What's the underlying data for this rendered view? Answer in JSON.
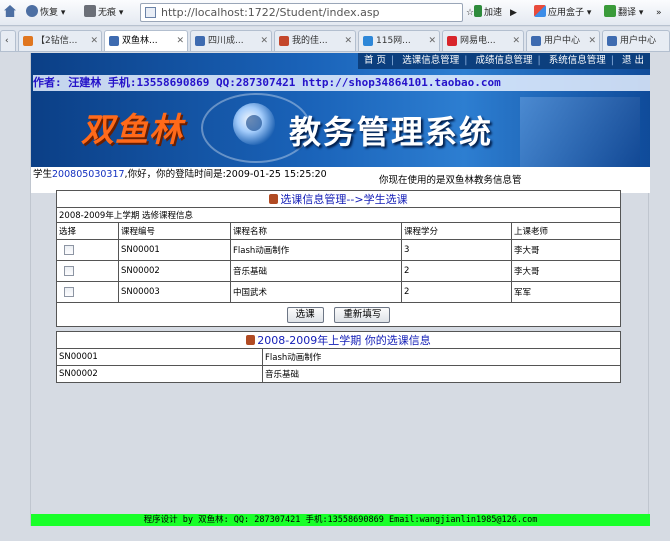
{
  "browser": {
    "back_label": "恢复",
    "mode_label": "无痕",
    "address": "http://localhost:1722/Student/index.asp",
    "accel_label": "加速",
    "appbox_label": "应用盒子",
    "translate_label": "翻译"
  },
  "tabs": [
    {
      "label": "【2钻信...",
      "active": false
    },
    {
      "label": "双鱼林...",
      "active": true
    },
    {
      "label": "四川成...",
      "active": false
    },
    {
      "label": "我的佳...",
      "active": false
    },
    {
      "label": "115网...",
      "active": false
    },
    {
      "label": "网易电...",
      "active": false
    },
    {
      "label": "用户中心",
      "active": false
    },
    {
      "label": "用户中心",
      "active": false
    }
  ],
  "topnav": {
    "home": "首 页",
    "select_mgmt": "选课信息管理",
    "score_mgmt": "成绩信息管理",
    "system_mgmt": "系统信息管理",
    "logout": "退 出"
  },
  "banner": {
    "author_line": "作者: 汪建林  手机:13558690869 QQ:287307421 http://shop34864101.taobao.com",
    "logo_brand": "双鱼林",
    "logo_title": "教务管理系统"
  },
  "welcome": {
    "prefix": "学生",
    "student_id": "200805030317",
    "suffix": ",你好，你的登陆时间是:2009-01-25 15:25:20",
    "system_note": "你现在使用的是双鱼林教务信息管"
  },
  "select_form": {
    "header": "选课信息管理-->学生选课",
    "term_line": "2008-2009年上学期  选修课程信息",
    "columns": [
      "选择",
      "课程编号",
      "课程名称",
      "课程学分",
      "上课老师"
    ],
    "rows": [
      {
        "code": "SN00001",
        "name": "Flash动画制作",
        "credit": "3",
        "teacher": "李大哥"
      },
      {
        "code": "SN00002",
        "name": "音乐基础",
        "credit": "2",
        "teacher": "李大哥"
      },
      {
        "code": "SN00003",
        "name": "中国武术",
        "credit": "2",
        "teacher": "军军"
      }
    ],
    "submit_label": "选课",
    "reset_label": "重新填写"
  },
  "my_courses": {
    "header": "2008-2009年上学期 你的选课信息",
    "rows": [
      {
        "code": "SN00001",
        "name": "Flash动画制作"
      },
      {
        "code": "SN00002",
        "name": "音乐基础"
      }
    ]
  },
  "footer": {
    "text": "程序设计 by 双鱼林: QQ: 287307421 手机:13558690869 Email:wangjianlin1985@126.com"
  }
}
